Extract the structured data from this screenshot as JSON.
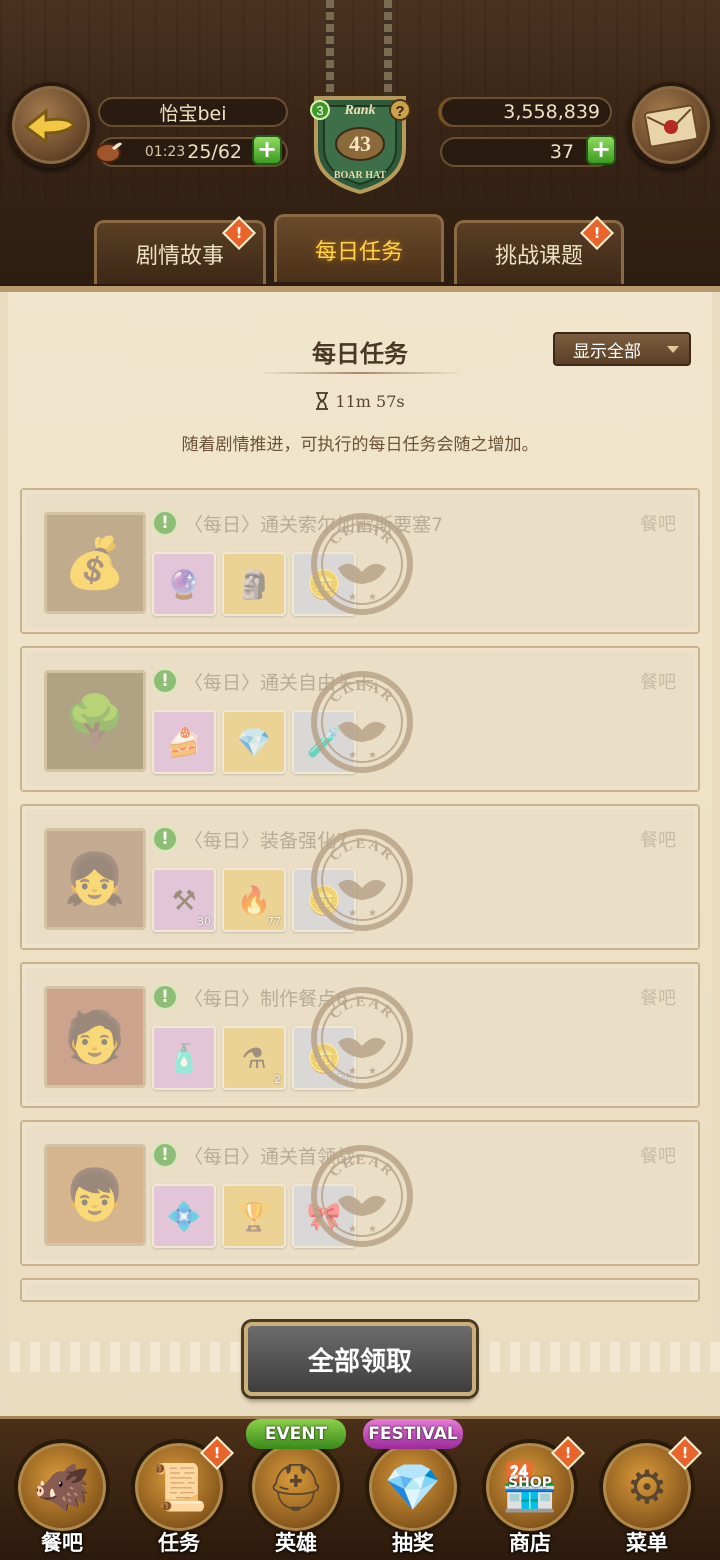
{
  "header": {
    "player_name": "怡宝bei",
    "stamina_timer": "01:23",
    "stamina": "25/62",
    "rank_label": "Rank",
    "rank_level": "43",
    "rank_badge_text": "BOAR HAT",
    "rank_badge_icon": "3",
    "help_icon": "?",
    "gold": "3,558,839",
    "gems": "37",
    "plus_symbol": "+"
  },
  "tabs": [
    {
      "label": "剧情故事",
      "active": false,
      "alert": "!"
    },
    {
      "label": "每日任务",
      "active": true
    },
    {
      "label": "挑战课题",
      "active": false,
      "alert": "!"
    }
  ],
  "panel": {
    "title": "每日任务",
    "filter_label": "显示全部",
    "timer": "11m 57s",
    "notice": "随着剧情推进，可执行的每日任务会随之增加。"
  },
  "quests": [
    {
      "title": "〈每日〉通关索尔加雷斯要塞7",
      "location": "餐吧",
      "icon": "!",
      "portrait": "treasure-icon",
      "rewards": [
        {
          "icon": "orb-icon",
          "qty": ""
        },
        {
          "icon": "statue-icon",
          "qty": ""
        },
        {
          "icon": "coin-icon",
          "qty": ""
        }
      ],
      "stamp": "CLEAR"
    },
    {
      "title": "〈每日〉通关自由关卡",
      "location": "餐吧",
      "icon": "!",
      "portrait": "forest-icon",
      "rewards": [
        {
          "icon": "food-icon",
          "qty": ""
        },
        {
          "icon": "diamond-icon",
          "qty": ""
        },
        {
          "icon": "potion-icon",
          "qty": ""
        }
      ],
      "stamp": "CLEAR"
    },
    {
      "title": "〈每日〉装备强化7",
      "location": "餐吧",
      "icon": "!",
      "portrait": "diane-portrait",
      "rewards": [
        {
          "icon": "anvil-icon",
          "qty": "30"
        },
        {
          "icon": "flame-icon",
          "qty": "77"
        },
        {
          "icon": "coin-icon",
          "qty": ""
        }
      ],
      "stamp": "CLEAR"
    },
    {
      "title": "〈每日〉制作餐点6",
      "location": "餐吧",
      "icon": "!",
      "portrait": "ban-portrait",
      "rewards": [
        {
          "icon": "bottle-icon",
          "qty": ""
        },
        {
          "icon": "flask-icon",
          "qty": "2"
        },
        {
          "icon": "coin-icon",
          "qty": "15"
        }
      ],
      "stamp": "CLEAR"
    },
    {
      "title": "〈每日〉通关首领战",
      "location": "餐吧",
      "icon": "!",
      "portrait": "king-portrait",
      "rewards": [
        {
          "icon": "crystal-icon",
          "qty": ""
        },
        {
          "icon": "trophy-icon",
          "qty": ""
        },
        {
          "icon": "pink-item-icon",
          "qty": ""
        }
      ],
      "stamp": "CLEAR"
    }
  ],
  "claim_all_label": "全部领取",
  "nav": [
    {
      "label": "餐吧",
      "icon": "boar-hat-icon",
      "alert": ""
    },
    {
      "label": "任务",
      "icon": "scroll-icon",
      "alert": "!"
    },
    {
      "label": "英雄",
      "icon": "helmet-icon",
      "alert": "",
      "tag": "EVENT"
    },
    {
      "label": "抽奖",
      "icon": "crystal-icon",
      "alert": "",
      "tag": "FESTIVAL"
    },
    {
      "label": "商店",
      "icon": "shop-icon",
      "alert": "!",
      "tag_text": "SHOP"
    },
    {
      "label": "菜单",
      "icon": "gear-icon",
      "alert": "!"
    }
  ],
  "colors": {
    "accent_gold": "#ffd24a",
    "alert_orange": "#e8642a",
    "plus_green": "#3d9a23"
  }
}
